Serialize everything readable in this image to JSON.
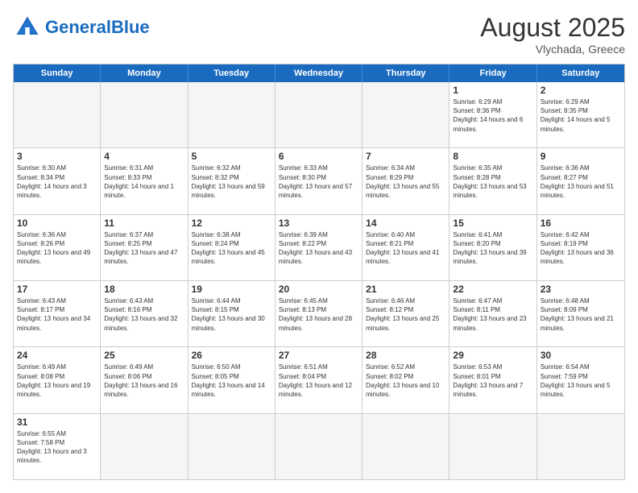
{
  "header": {
    "logo_general": "General",
    "logo_blue": "Blue",
    "title": "August 2025",
    "subtitle": "Vlychada, Greece"
  },
  "days_of_week": [
    "Sunday",
    "Monday",
    "Tuesday",
    "Wednesday",
    "Thursday",
    "Friday",
    "Saturday"
  ],
  "weeks": [
    [
      {
        "day": "",
        "empty": true
      },
      {
        "day": "",
        "empty": true
      },
      {
        "day": "",
        "empty": true
      },
      {
        "day": "",
        "empty": true
      },
      {
        "day": "",
        "empty": true
      },
      {
        "day": "1",
        "info": "Sunrise: 6:29 AM\nSunset: 8:36 PM\nDaylight: 14 hours and 6 minutes."
      },
      {
        "day": "2",
        "info": "Sunrise: 6:29 AM\nSunset: 8:35 PM\nDaylight: 14 hours and 5 minutes."
      }
    ],
    [
      {
        "day": "3",
        "info": "Sunrise: 6:30 AM\nSunset: 8:34 PM\nDaylight: 14 hours and 3 minutes."
      },
      {
        "day": "4",
        "info": "Sunrise: 6:31 AM\nSunset: 8:33 PM\nDaylight: 14 hours and 1 minute."
      },
      {
        "day": "5",
        "info": "Sunrise: 6:32 AM\nSunset: 8:32 PM\nDaylight: 13 hours and 59 minutes."
      },
      {
        "day": "6",
        "info": "Sunrise: 6:33 AM\nSunset: 8:30 PM\nDaylight: 13 hours and 57 minutes."
      },
      {
        "day": "7",
        "info": "Sunrise: 6:34 AM\nSunset: 8:29 PM\nDaylight: 13 hours and 55 minutes."
      },
      {
        "day": "8",
        "info": "Sunrise: 6:35 AM\nSunset: 8:28 PM\nDaylight: 13 hours and 53 minutes."
      },
      {
        "day": "9",
        "info": "Sunrise: 6:36 AM\nSunset: 8:27 PM\nDaylight: 13 hours and 51 minutes."
      }
    ],
    [
      {
        "day": "10",
        "info": "Sunrise: 6:36 AM\nSunset: 8:26 PM\nDaylight: 13 hours and 49 minutes."
      },
      {
        "day": "11",
        "info": "Sunrise: 6:37 AM\nSunset: 8:25 PM\nDaylight: 13 hours and 47 minutes."
      },
      {
        "day": "12",
        "info": "Sunrise: 6:38 AM\nSunset: 8:24 PM\nDaylight: 13 hours and 45 minutes."
      },
      {
        "day": "13",
        "info": "Sunrise: 6:39 AM\nSunset: 8:22 PM\nDaylight: 13 hours and 43 minutes."
      },
      {
        "day": "14",
        "info": "Sunrise: 6:40 AM\nSunset: 8:21 PM\nDaylight: 13 hours and 41 minutes."
      },
      {
        "day": "15",
        "info": "Sunrise: 6:41 AM\nSunset: 8:20 PM\nDaylight: 13 hours and 39 minutes."
      },
      {
        "day": "16",
        "info": "Sunrise: 6:42 AM\nSunset: 8:19 PM\nDaylight: 13 hours and 36 minutes."
      }
    ],
    [
      {
        "day": "17",
        "info": "Sunrise: 6:43 AM\nSunset: 8:17 PM\nDaylight: 13 hours and 34 minutes."
      },
      {
        "day": "18",
        "info": "Sunrise: 6:43 AM\nSunset: 8:16 PM\nDaylight: 13 hours and 32 minutes."
      },
      {
        "day": "19",
        "info": "Sunrise: 6:44 AM\nSunset: 8:15 PM\nDaylight: 13 hours and 30 minutes."
      },
      {
        "day": "20",
        "info": "Sunrise: 6:45 AM\nSunset: 8:13 PM\nDaylight: 13 hours and 28 minutes."
      },
      {
        "day": "21",
        "info": "Sunrise: 6:46 AM\nSunset: 8:12 PM\nDaylight: 13 hours and 25 minutes."
      },
      {
        "day": "22",
        "info": "Sunrise: 6:47 AM\nSunset: 8:11 PM\nDaylight: 13 hours and 23 minutes."
      },
      {
        "day": "23",
        "info": "Sunrise: 6:48 AM\nSunset: 8:09 PM\nDaylight: 13 hours and 21 minutes."
      }
    ],
    [
      {
        "day": "24",
        "info": "Sunrise: 6:49 AM\nSunset: 8:08 PM\nDaylight: 13 hours and 19 minutes."
      },
      {
        "day": "25",
        "info": "Sunrise: 6:49 AM\nSunset: 8:06 PM\nDaylight: 13 hours and 16 minutes."
      },
      {
        "day": "26",
        "info": "Sunrise: 6:50 AM\nSunset: 8:05 PM\nDaylight: 13 hours and 14 minutes."
      },
      {
        "day": "27",
        "info": "Sunrise: 6:51 AM\nSunset: 8:04 PM\nDaylight: 13 hours and 12 minutes."
      },
      {
        "day": "28",
        "info": "Sunrise: 6:52 AM\nSunset: 8:02 PM\nDaylight: 13 hours and 10 minutes."
      },
      {
        "day": "29",
        "info": "Sunrise: 6:53 AM\nSunset: 8:01 PM\nDaylight: 13 hours and 7 minutes."
      },
      {
        "day": "30",
        "info": "Sunrise: 6:54 AM\nSunset: 7:59 PM\nDaylight: 13 hours and 5 minutes."
      }
    ],
    [
      {
        "day": "31",
        "info": "Sunrise: 6:55 AM\nSunset: 7:58 PM\nDaylight: 13 hours and 3 minutes."
      },
      {
        "day": "",
        "empty": true
      },
      {
        "day": "",
        "empty": true
      },
      {
        "day": "",
        "empty": true
      },
      {
        "day": "",
        "empty": true
      },
      {
        "day": "",
        "empty": true
      },
      {
        "day": "",
        "empty": true
      }
    ]
  ]
}
